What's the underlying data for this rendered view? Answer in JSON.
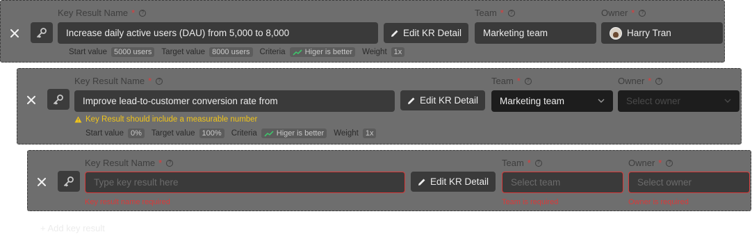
{
  "labels": {
    "kr_name": "Key Result Name",
    "required_mark": "*",
    "help_glyph": "?",
    "team": "Team",
    "owner": "Owner",
    "edit_button": "Edit KR Detail",
    "start_value": "Start value",
    "target_value": "Target value",
    "criteria": "Criteria",
    "weight": "Weight"
  },
  "rows": [
    {
      "kr_name": "Increase daily active users (DAU) from 5,000 to 8,000",
      "team": "Marketing team",
      "owner": "Harry Tran",
      "start_value": "5000 users",
      "target_value": "8000 users",
      "criteria": "Higer is better",
      "weight": "1x"
    },
    {
      "kr_name": "Improve lead-to-customer conversion rate from",
      "team": "Marketing team",
      "owner_placeholder": "Select owner",
      "warning": "Key Result should include a measurable number",
      "start_value": "0%",
      "target_value": "100%",
      "criteria": "Higer is better",
      "weight": "1x"
    },
    {
      "kr_name_placeholder": "Type key result here",
      "team_placeholder": "Select team",
      "owner_placeholder": "Select owner",
      "kr_name_error": "Key result name required",
      "team_error": "Team is required",
      "owner_error": "Owner is required"
    }
  ],
  "add_key_result": "+ Add key result",
  "colors": {
    "card_bg": "#6e6e6e",
    "field_bg": "#3a3a3a",
    "dark_field_bg": "#1d1d1d",
    "error": "#d93a3a",
    "warning": "#f0c419",
    "criteria_icon": "#3fc46b"
  },
  "icons": [
    "close-icon",
    "key-icon",
    "pencil-icon",
    "help-icon",
    "chevron-down-icon",
    "trend-up-icon",
    "warning-icon",
    "avatar"
  ]
}
